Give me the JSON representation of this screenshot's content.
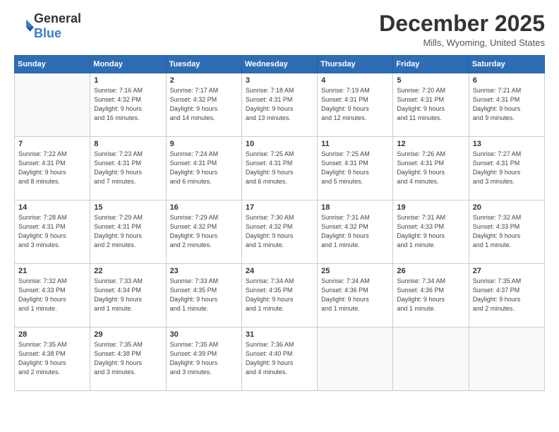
{
  "header": {
    "logo_general": "General",
    "logo_blue": "Blue",
    "month_title": "December 2025",
    "location": "Mills, Wyoming, United States"
  },
  "weekdays": [
    "Sunday",
    "Monday",
    "Tuesday",
    "Wednesday",
    "Thursday",
    "Friday",
    "Saturday"
  ],
  "weeks": [
    [
      {
        "day": "",
        "info": ""
      },
      {
        "day": "1",
        "info": "Sunrise: 7:16 AM\nSunset: 4:32 PM\nDaylight: 9 hours\nand 16 minutes."
      },
      {
        "day": "2",
        "info": "Sunrise: 7:17 AM\nSunset: 4:32 PM\nDaylight: 9 hours\nand 14 minutes."
      },
      {
        "day": "3",
        "info": "Sunrise: 7:18 AM\nSunset: 4:31 PM\nDaylight: 9 hours\nand 13 minutes."
      },
      {
        "day": "4",
        "info": "Sunrise: 7:19 AM\nSunset: 4:31 PM\nDaylight: 9 hours\nand 12 minutes."
      },
      {
        "day": "5",
        "info": "Sunrise: 7:20 AM\nSunset: 4:31 PM\nDaylight: 9 hours\nand 11 minutes."
      },
      {
        "day": "6",
        "info": "Sunrise: 7:21 AM\nSunset: 4:31 PM\nDaylight: 9 hours\nand 9 minutes."
      }
    ],
    [
      {
        "day": "7",
        "info": "Sunrise: 7:22 AM\nSunset: 4:31 PM\nDaylight: 9 hours\nand 8 minutes."
      },
      {
        "day": "8",
        "info": "Sunrise: 7:23 AM\nSunset: 4:31 PM\nDaylight: 9 hours\nand 7 minutes."
      },
      {
        "day": "9",
        "info": "Sunrise: 7:24 AM\nSunset: 4:31 PM\nDaylight: 9 hours\nand 6 minutes."
      },
      {
        "day": "10",
        "info": "Sunrise: 7:25 AM\nSunset: 4:31 PM\nDaylight: 9 hours\nand 6 minutes."
      },
      {
        "day": "11",
        "info": "Sunrise: 7:25 AM\nSunset: 4:31 PM\nDaylight: 9 hours\nand 5 minutes."
      },
      {
        "day": "12",
        "info": "Sunrise: 7:26 AM\nSunset: 4:31 PM\nDaylight: 9 hours\nand 4 minutes."
      },
      {
        "day": "13",
        "info": "Sunrise: 7:27 AM\nSunset: 4:31 PM\nDaylight: 9 hours\nand 3 minutes."
      }
    ],
    [
      {
        "day": "14",
        "info": "Sunrise: 7:28 AM\nSunset: 4:31 PM\nDaylight: 9 hours\nand 3 minutes."
      },
      {
        "day": "15",
        "info": "Sunrise: 7:29 AM\nSunset: 4:31 PM\nDaylight: 9 hours\nand 2 minutes."
      },
      {
        "day": "16",
        "info": "Sunrise: 7:29 AM\nSunset: 4:32 PM\nDaylight: 9 hours\nand 2 minutes."
      },
      {
        "day": "17",
        "info": "Sunrise: 7:30 AM\nSunset: 4:32 PM\nDaylight: 9 hours\nand 1 minute."
      },
      {
        "day": "18",
        "info": "Sunrise: 7:31 AM\nSunset: 4:32 PM\nDaylight: 9 hours\nand 1 minute."
      },
      {
        "day": "19",
        "info": "Sunrise: 7:31 AM\nSunset: 4:33 PM\nDaylight: 9 hours\nand 1 minute."
      },
      {
        "day": "20",
        "info": "Sunrise: 7:32 AM\nSunset: 4:33 PM\nDaylight: 9 hours\nand 1 minute."
      }
    ],
    [
      {
        "day": "21",
        "info": "Sunrise: 7:32 AM\nSunset: 4:33 PM\nDaylight: 9 hours\nand 1 minute."
      },
      {
        "day": "22",
        "info": "Sunrise: 7:33 AM\nSunset: 4:34 PM\nDaylight: 9 hours\nand 1 minute."
      },
      {
        "day": "23",
        "info": "Sunrise: 7:33 AM\nSunset: 4:35 PM\nDaylight: 9 hours\nand 1 minute."
      },
      {
        "day": "24",
        "info": "Sunrise: 7:34 AM\nSunset: 4:35 PM\nDaylight: 9 hours\nand 1 minute."
      },
      {
        "day": "25",
        "info": "Sunrise: 7:34 AM\nSunset: 4:36 PM\nDaylight: 9 hours\nand 1 minute."
      },
      {
        "day": "26",
        "info": "Sunrise: 7:34 AM\nSunset: 4:36 PM\nDaylight: 9 hours\nand 1 minute."
      },
      {
        "day": "27",
        "info": "Sunrise: 7:35 AM\nSunset: 4:37 PM\nDaylight: 9 hours\nand 2 minutes."
      }
    ],
    [
      {
        "day": "28",
        "info": "Sunrise: 7:35 AM\nSunset: 4:38 PM\nDaylight: 9 hours\nand 2 minutes."
      },
      {
        "day": "29",
        "info": "Sunrise: 7:35 AM\nSunset: 4:38 PM\nDaylight: 9 hours\nand 3 minutes."
      },
      {
        "day": "30",
        "info": "Sunrise: 7:35 AM\nSunset: 4:39 PM\nDaylight: 9 hours\nand 3 minutes."
      },
      {
        "day": "31",
        "info": "Sunrise: 7:36 AM\nSunset: 4:40 PM\nDaylight: 9 hours\nand 4 minutes."
      },
      {
        "day": "",
        "info": ""
      },
      {
        "day": "",
        "info": ""
      },
      {
        "day": "",
        "info": ""
      }
    ]
  ]
}
